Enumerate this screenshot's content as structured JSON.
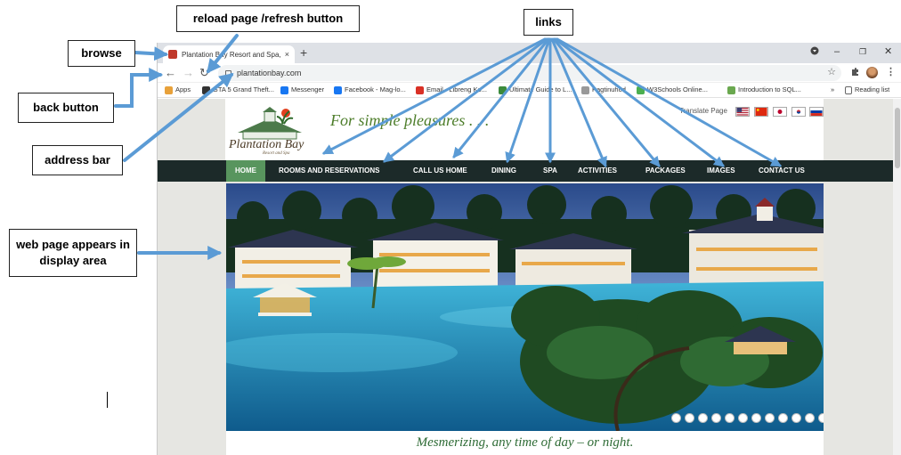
{
  "annotations": {
    "browse": "browse",
    "reload": "reload page /refresh button",
    "links": "links",
    "back": "back button",
    "address": "address bar",
    "display": "web page appears in display area"
  },
  "browser": {
    "tab_title": "Plantation Bay Resort and Spa, C",
    "tab_close": "×",
    "new_tab": "+",
    "window_controls": {
      "minimize": "–",
      "restore": "❐",
      "close": "✕"
    },
    "url": "plantationbay.com",
    "bookmarks": [
      {
        "label": "Apps",
        "icon": "apps-grid-icon",
        "color": "#e8a13a"
      },
      {
        "label": "GTA 5 Grand Theft...",
        "icon": "gta-icon",
        "color": "#333333"
      },
      {
        "label": "Messenger",
        "icon": "facebook-icon",
        "color": "#1877f2"
      },
      {
        "label": "Facebook - Mag-lo...",
        "icon": "facebook-icon",
        "color": "#1877f2"
      },
      {
        "label": "Email - Libreng Ko...",
        "icon": "gmail-icon",
        "color": "#d93025"
      },
      {
        "label": "Ultimate Guide to L...",
        "icon": "guide-icon",
        "color": "#3b8a3b"
      },
      {
        "label": "Pagtinuhod",
        "icon": "music-icon",
        "color": "#999999"
      },
      {
        "label": "W3Schools Online...",
        "icon": "w3schools-icon",
        "color": "#4caf50"
      },
      {
        "label": "Introduction to SQL...",
        "icon": "sql-icon",
        "color": "#6aa84f"
      }
    ],
    "reading_list": "Reading list"
  },
  "site": {
    "logo_text": "Plantation Bay",
    "logo_sub": "Resort and Spa",
    "tagline": "For simple pleasures . . .",
    "translate_label": "Translate Page",
    "nav": [
      "HOME",
      "ROOMS AND RESERVATIONS",
      "CALL US HOME",
      "DINING",
      "SPA",
      "ACTIVITIES",
      "PACKAGES",
      "IMAGES",
      "CONTACT US"
    ],
    "active_nav": "HOME",
    "slide_count": 16,
    "active_slide": 13,
    "motto": "Mesmerizing, any time of day – or night."
  }
}
